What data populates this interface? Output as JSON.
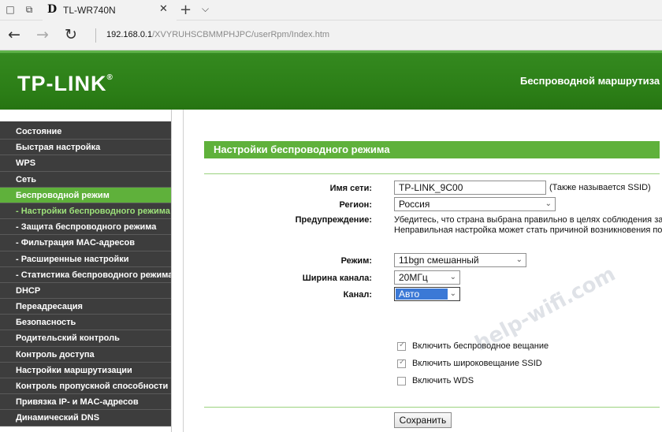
{
  "browser": {
    "tab_title": "TL-WR740N",
    "tab_favicon": "D",
    "url_host": "192.168.0.1",
    "url_path": "/XVYRUHSCBMMPHJPC/userRpm/Index.htm",
    "icons": {
      "tabs_aside": "□",
      "tab_preview": "⧉",
      "close": "✕",
      "new_tab": "+",
      "tab_menu": "⌵",
      "back": "←",
      "forward": "→",
      "refresh": "↻"
    }
  },
  "header": {
    "logo": "TP-LINK",
    "logo_mark": "®",
    "product": "Беспроводной маршрутиза"
  },
  "sidebar": {
    "items": [
      {
        "label": "Состояние"
      },
      {
        "label": "Быстрая настройка"
      },
      {
        "label": "WPS"
      },
      {
        "label": "Сеть"
      },
      {
        "label": "Беспроводной режим"
      },
      {
        "label": "- Настройки беспроводного режима"
      },
      {
        "label": "- Защита беспроводного режима"
      },
      {
        "label": "- Фильтрация MAC-адресов"
      },
      {
        "label": "- Расширенные настройки"
      },
      {
        "label": "- Статистика беспроводного режима"
      },
      {
        "label": "DHCP"
      },
      {
        "label": "Переадресация"
      },
      {
        "label": "Безопасность"
      },
      {
        "label": "Родительский контроль"
      },
      {
        "label": "Контроль доступа"
      },
      {
        "label": "Настройки маршрутизации"
      },
      {
        "label": "Контроль пропускной способности"
      },
      {
        "label": "Привязка IP- и MAC-адресов"
      },
      {
        "label": "Динамический DNS"
      }
    ]
  },
  "main": {
    "section_title": "Настройки беспроводного режима",
    "ssid_label": "Имя сети:",
    "ssid_value": "TP-LINK_9C00",
    "ssid_note": "(Также называется SSID)",
    "region_label": "Регион:",
    "region_value": "Россия",
    "warning_label": "Предупреждение:",
    "warning_line1": "Убедитесь, что страна выбрана правильно в целях соблюдения законо",
    "warning_line2": "Неправильная настройка может стать причиной возникновения помех.",
    "mode_label": "Режим:",
    "mode_value": "11bgn смешанный",
    "width_label": "Ширина канала:",
    "width_value": "20МГц",
    "channel_label": "Канал:",
    "channel_value": "Авто",
    "cb_broadcast": {
      "label": "Включить беспроводное вещание",
      "checked": true
    },
    "cb_ssid": {
      "label": "Включить широковещание SSID",
      "checked": true
    },
    "cb_wds": {
      "label": "Включить WDS",
      "checked": false
    },
    "save_label": "Сохранить"
  },
  "watermark": "help-wifi.com"
}
